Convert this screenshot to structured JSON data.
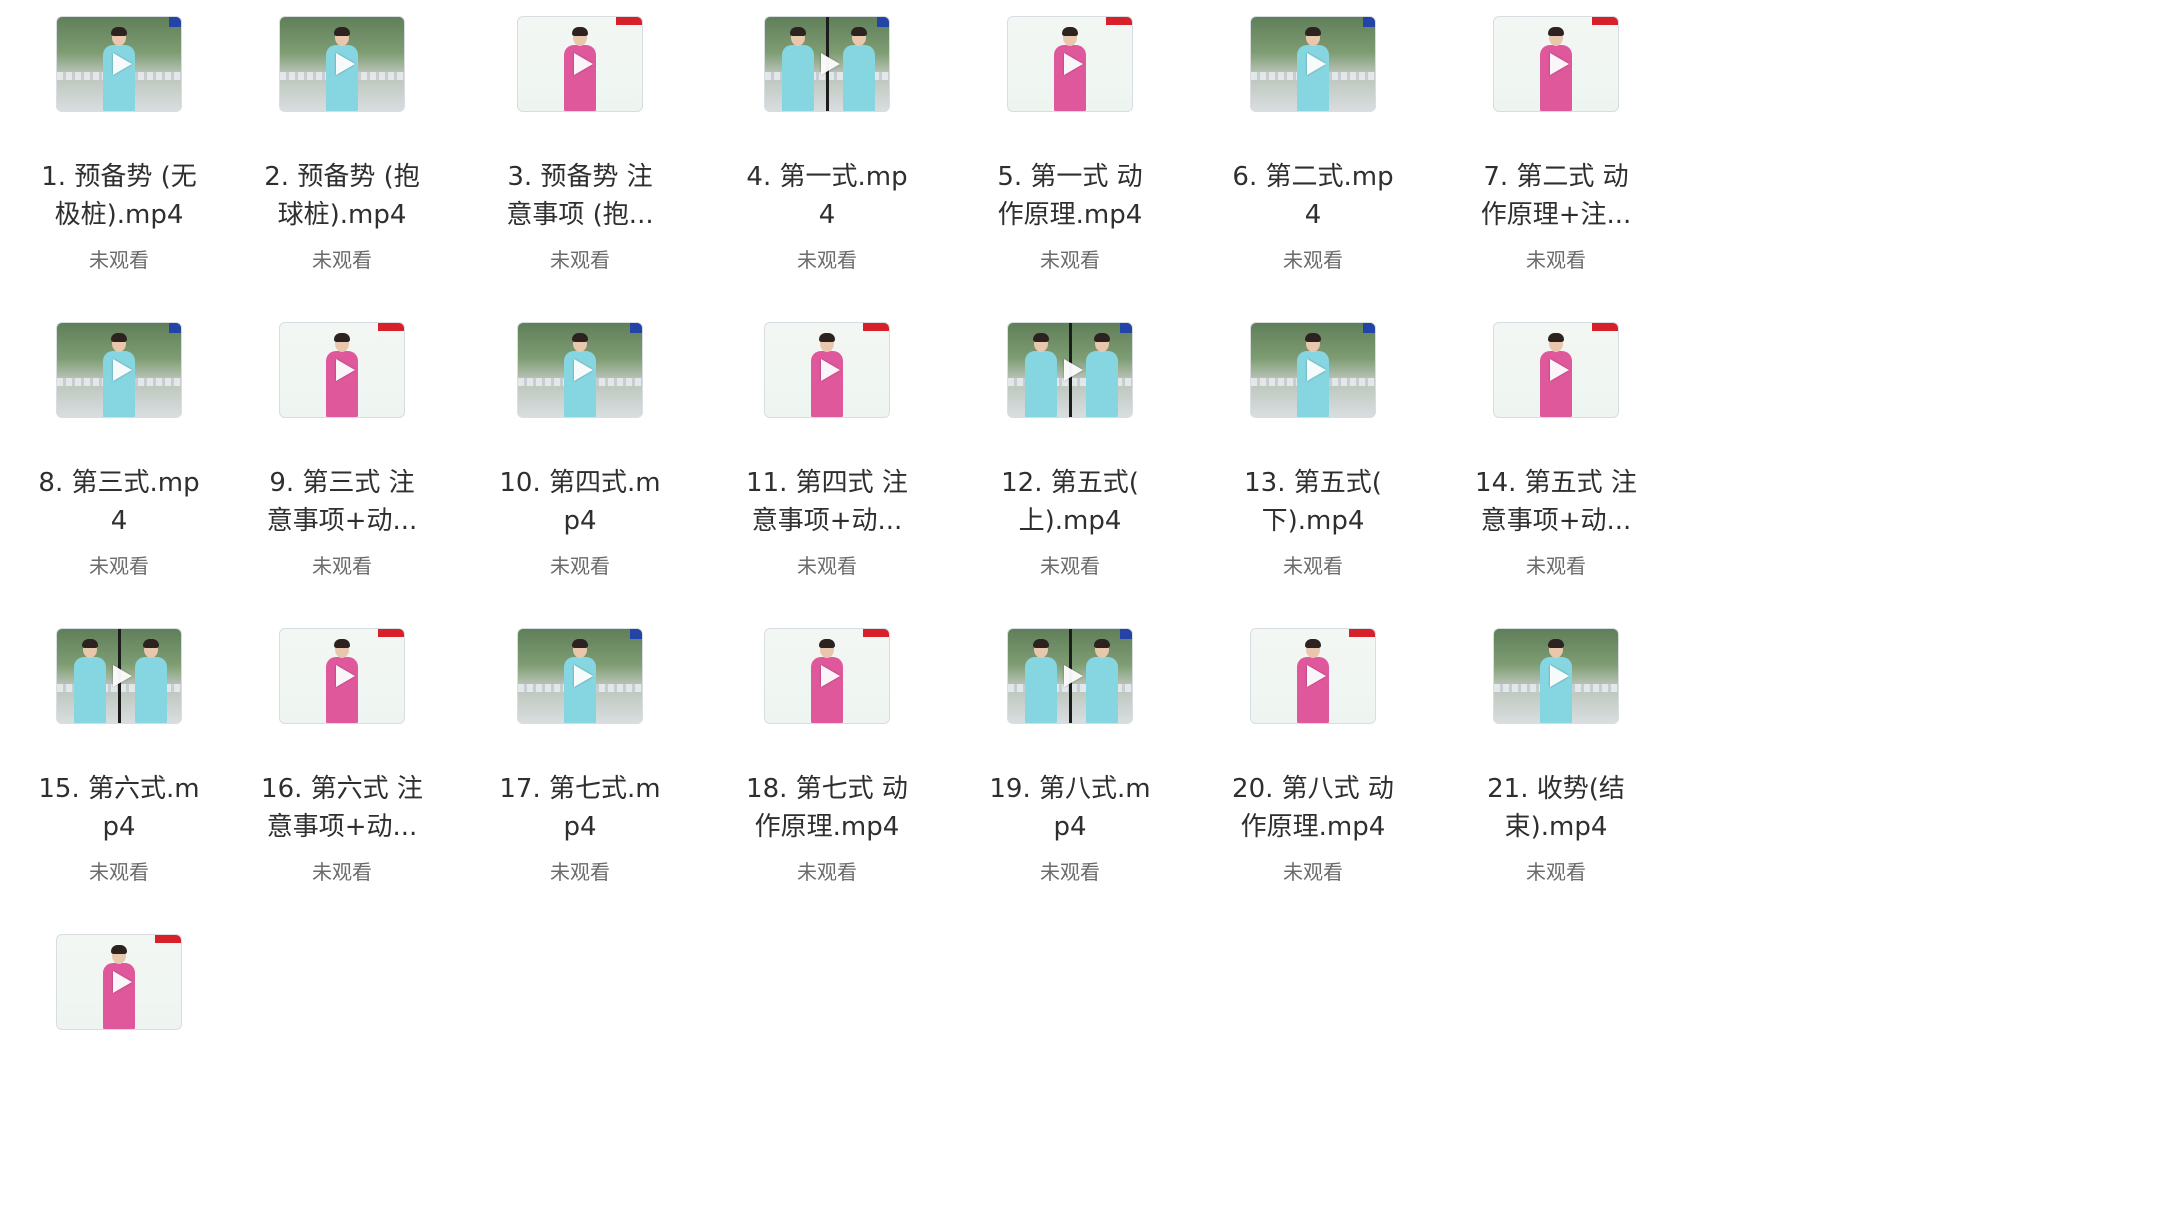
{
  "videos": [
    {
      "title_lines": [
        "1. 预备势 (无",
        "极桩).mp4"
      ],
      "status": "未观看",
      "thumb": "scene-cyan",
      "badge": "blue"
    },
    {
      "title_lines": [
        "2. 预备势 (抱",
        "球桩).mp4"
      ],
      "status": "未观看",
      "thumb": "scene-cyan",
      "badge": "none"
    },
    {
      "title_lines": [
        "3. 预备势 注",
        "意事项 (抱..."
      ],
      "status": "未观看",
      "thumb": "studio-pink",
      "badge": "red"
    },
    {
      "title_lines": [
        "4. 第一式.mp",
        "4"
      ],
      "status": "未观看",
      "thumb": "split-cyan",
      "badge": "blue"
    },
    {
      "title_lines": [
        "5. 第一式 动",
        "作原理.mp4"
      ],
      "status": "未观看",
      "thumb": "studio-pink",
      "badge": "red"
    },
    {
      "title_lines": [
        "6. 第二式.mp",
        "4"
      ],
      "status": "未观看",
      "thumb": "scene-cyan",
      "badge": "blue"
    },
    {
      "title_lines": [
        "7. 第二式 动",
        "作原理+注..."
      ],
      "status": "未观看",
      "thumb": "studio-pink",
      "badge": "red"
    },
    {
      "title_lines": [
        "8. 第三式.mp",
        "4"
      ],
      "status": "未观看",
      "thumb": "scene-cyan",
      "badge": "blue"
    },
    {
      "title_lines": [
        "9. 第三式 注",
        "意事项+动..."
      ],
      "status": "未观看",
      "thumb": "studio-pink",
      "badge": "red"
    },
    {
      "title_lines": [
        "10. 第四式.m",
        "p4"
      ],
      "status": "未观看",
      "thumb": "scene-cyan",
      "badge": "blue"
    },
    {
      "title_lines": [
        "11. 第四式 注",
        "意事项+动..."
      ],
      "status": "未观看",
      "thumb": "studio-pink",
      "badge": "red"
    },
    {
      "title_lines": [
        "12. 第五式(",
        "上).mp4"
      ],
      "status": "未观看",
      "thumb": "split-cyan",
      "badge": "blue"
    },
    {
      "title_lines": [
        "13. 第五式(",
        "下).mp4"
      ],
      "status": "未观看",
      "thumb": "scene-cyan",
      "badge": "blue"
    },
    {
      "title_lines": [
        "14. 第五式 注",
        "意事项+动..."
      ],
      "status": "未观看",
      "thumb": "studio-pink",
      "badge": "red"
    },
    {
      "title_lines": [
        "15. 第六式.m",
        "p4"
      ],
      "status": "未观看",
      "thumb": "split-cyan",
      "badge": "none"
    },
    {
      "title_lines": [
        "16. 第六式 注",
        "意事项+动..."
      ],
      "status": "未观看",
      "thumb": "studio-pink",
      "badge": "red"
    },
    {
      "title_lines": [
        "17. 第七式.m",
        "p4"
      ],
      "status": "未观看",
      "thumb": "scene-cyan",
      "badge": "blue"
    },
    {
      "title_lines": [
        "18. 第七式 动",
        "作原理.mp4"
      ],
      "status": "未观看",
      "thumb": "studio-pink",
      "badge": "red"
    },
    {
      "title_lines": [
        "19. 第八式.m",
        "p4"
      ],
      "status": "未观看",
      "thumb": "split-cyan",
      "badge": "blue"
    },
    {
      "title_lines": [
        "20. 第八式 动",
        "作原理.mp4"
      ],
      "status": "未观看",
      "thumb": "studio-pink",
      "badge": "red"
    },
    {
      "title_lines": [
        "21. 收势(结",
        "束).mp4"
      ],
      "status": "未观看",
      "thumb": "scene-cyan",
      "badge": "none"
    },
    {
      "title_lines": [],
      "status": "",
      "thumb": "studio-pink",
      "badge": "red"
    }
  ]
}
